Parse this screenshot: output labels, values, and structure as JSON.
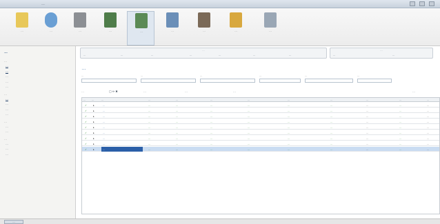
{
  "window": {
    "title": "…"
  },
  "toolbar": {
    "items": [
      {
        "label": "…",
        "icon": "desk-icon"
      },
      {
        "label": "…",
        "icon": "globe-icon"
      },
      {
        "label": "…",
        "icon": "printer-icon"
      },
      {
        "label": "…",
        "icon": "warehouse-icon"
      },
      {
        "label": "…",
        "icon": "folder-icon"
      },
      {
        "label": "…",
        "icon": "machine-icon"
      },
      {
        "label": "…",
        "icon": "worker-icon"
      },
      {
        "label": "…",
        "icon": "building-icon"
      },
      {
        "label": "…",
        "icon": "settings-icon"
      }
    ]
  },
  "sidebar": {
    "header": "…",
    "groups": [
      {
        "title": "…",
        "items": [
          "…",
          "…",
          "…",
          "…",
          "…"
        ]
      },
      {
        "title": "…",
        "items": [
          "…",
          "…",
          "…",
          "…"
        ]
      },
      {
        "title": "…",
        "items": [
          "…",
          "…"
        ]
      },
      {
        "title": "…",
        "items": [
          "…",
          "…",
          "…"
        ]
      }
    ]
  },
  "ribbon": {
    "groups": [
      {
        "title": "…",
        "buttons": [
          "…",
          "…",
          "…",
          "…",
          "…",
          "…",
          "…"
        ]
      },
      {
        "title": "…",
        "buttons": [
          "…",
          "…"
        ]
      }
    ]
  },
  "document": {
    "title": "…"
  },
  "filters": [
    {
      "label": "…",
      "value": ""
    },
    {
      "label": "…",
      "value": ""
    },
    {
      "label": "…",
      "value": ""
    },
    {
      "label": "…",
      "value": ""
    },
    {
      "label": "…",
      "value": ""
    },
    {
      "label": "…",
      "value": ""
    }
  ],
  "actions": {
    "create": "…",
    "more": "…",
    "filter": "…",
    "print": "…",
    "right_link": "…"
  },
  "grid": {
    "columns": [
      "…",
      "…",
      "…",
      "…",
      "…",
      "…",
      "…",
      "…",
      "…",
      "…",
      "…",
      "…"
    ],
    "rows": [
      {
        "date": "…",
        "num": "…",
        "status": "…",
        "op": "…",
        "sender": "…",
        "recv": "…",
        "unit": "…",
        "qty": "…",
        "dest": "…",
        "sum": "…",
        "selected": false
      },
      {
        "date": "…",
        "num": "…",
        "status": "…",
        "op": "…",
        "sender": "…",
        "recv": "…",
        "unit": "…",
        "qty": "…",
        "dest": "…",
        "sum": "…",
        "selected": false
      },
      {
        "date": "…",
        "num": "…",
        "status": "…",
        "op": "…",
        "sender": "…",
        "recv": "…",
        "unit": "…",
        "qty": "…",
        "dest": "…",
        "sum": "…",
        "selected": false
      },
      {
        "date": "…",
        "num": "…",
        "status": "…",
        "op": "…",
        "sender": "…",
        "recv": "…",
        "unit": "…",
        "qty": "…",
        "dest": "…",
        "sum": "…",
        "selected": false
      },
      {
        "date": "…",
        "num": "…",
        "status": "…",
        "op": "…",
        "sender": "…",
        "recv": "…",
        "unit": "…",
        "qty": "…",
        "dest": "…",
        "sum": "…",
        "selected": false
      },
      {
        "date": "…",
        "num": "…",
        "status": "…",
        "op": "…",
        "sender": "…",
        "recv": "…",
        "unit": "…",
        "qty": "…",
        "dest": "…",
        "sum": "…",
        "selected": false
      },
      {
        "date": "…",
        "num": "…",
        "status": "…",
        "op": "…",
        "sender": "…",
        "recv": "…",
        "unit": "…",
        "qty": "…",
        "dest": "…",
        "sum": "…",
        "selected": false
      },
      {
        "date": "…",
        "num": "…",
        "status": "…",
        "op": "…",
        "sender": "…",
        "recv": "…",
        "unit": "…",
        "qty": "…",
        "dest": "…",
        "sum": "…",
        "selected": false
      },
      {
        "date": "…",
        "num": "…",
        "status": "…",
        "op": "…",
        "sender": "…",
        "recv": "…",
        "unit": "…",
        "qty": "…",
        "dest": "…",
        "sum": "…",
        "selected": true
      }
    ]
  },
  "statusbar": {
    "tab": "…"
  },
  "colors": {
    "accent": "#3a6ea5",
    "row_status_green": "#2c8a2c",
    "selection": "#c9dcf2",
    "selected_cell": "#2b5fa8"
  }
}
